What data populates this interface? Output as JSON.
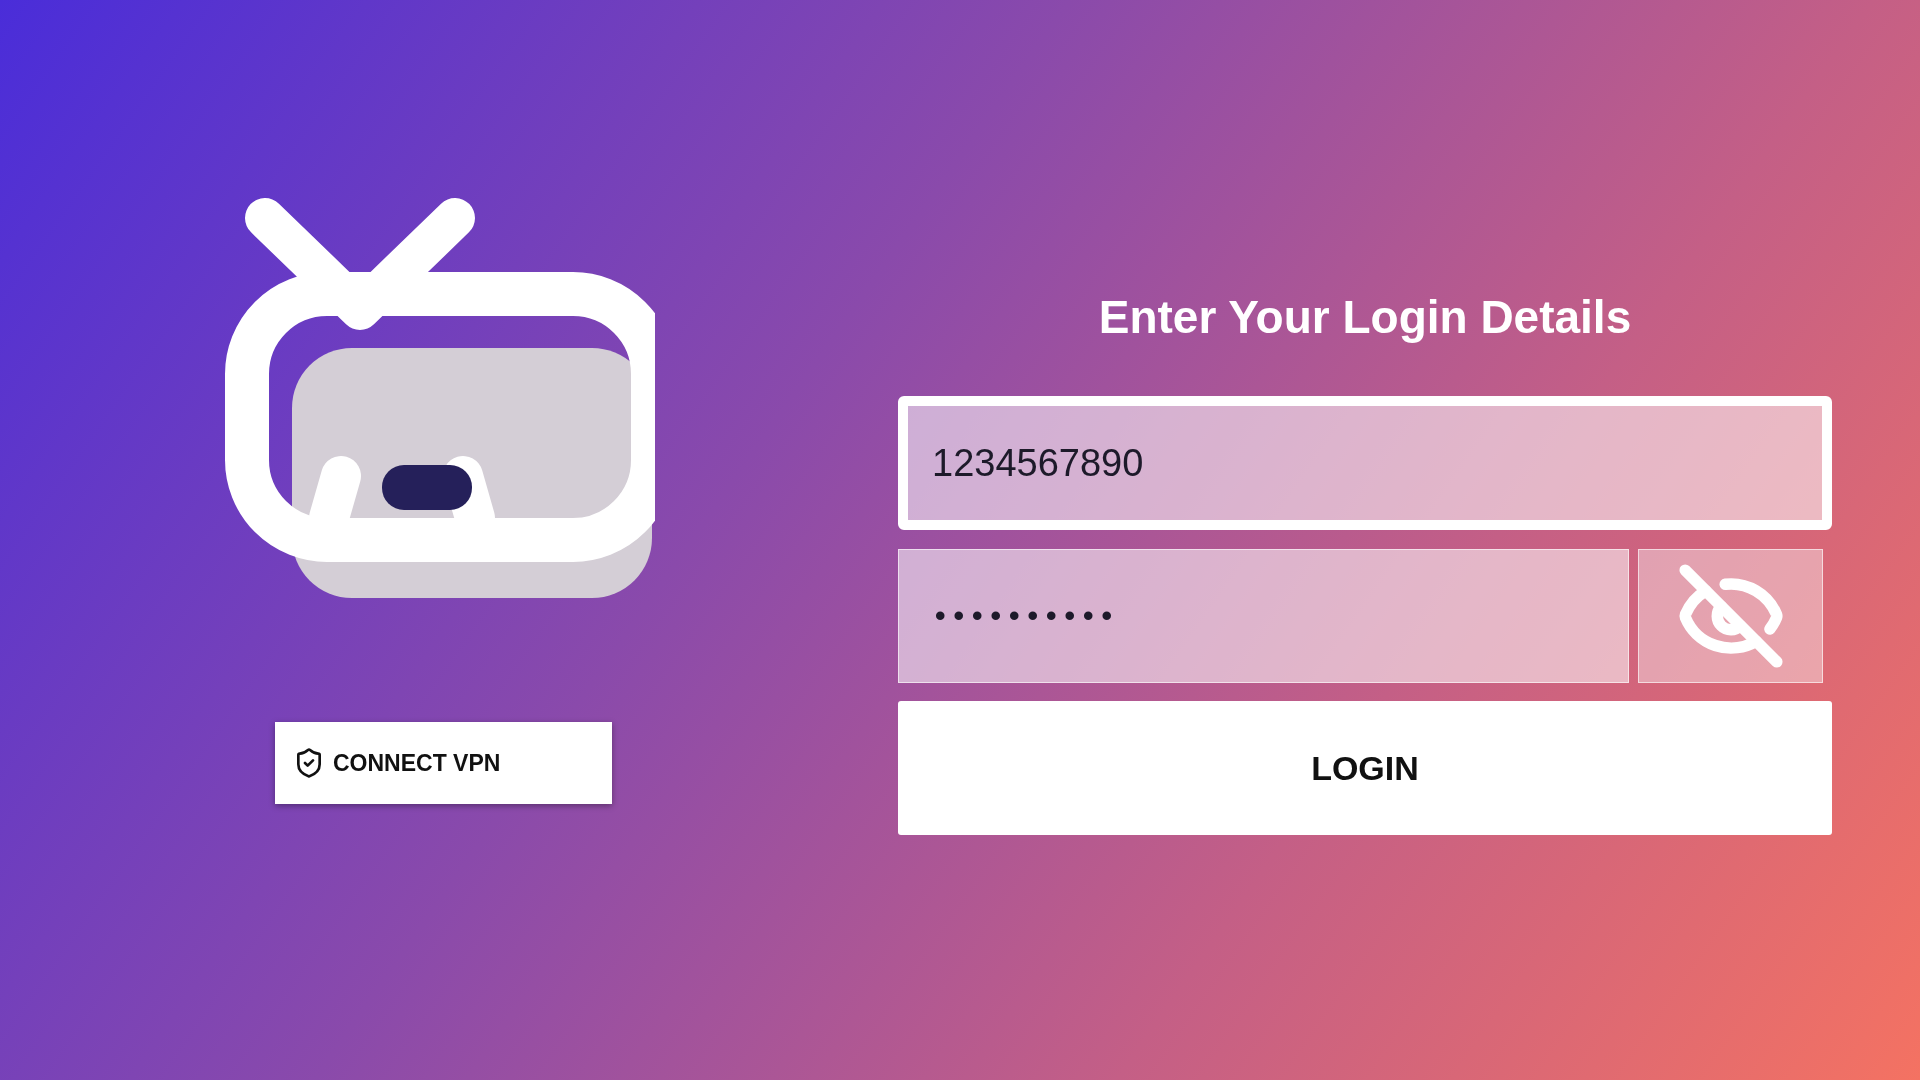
{
  "vpn_button": {
    "label": "CONNECT VPN"
  },
  "login": {
    "title": "Enter Your Login Details",
    "username": {
      "value": "1234567890",
      "focused": true
    },
    "password": {
      "value": "••••••••••",
      "focused": false,
      "visible": false
    },
    "submit": {
      "label": "LOGIN"
    }
  }
}
